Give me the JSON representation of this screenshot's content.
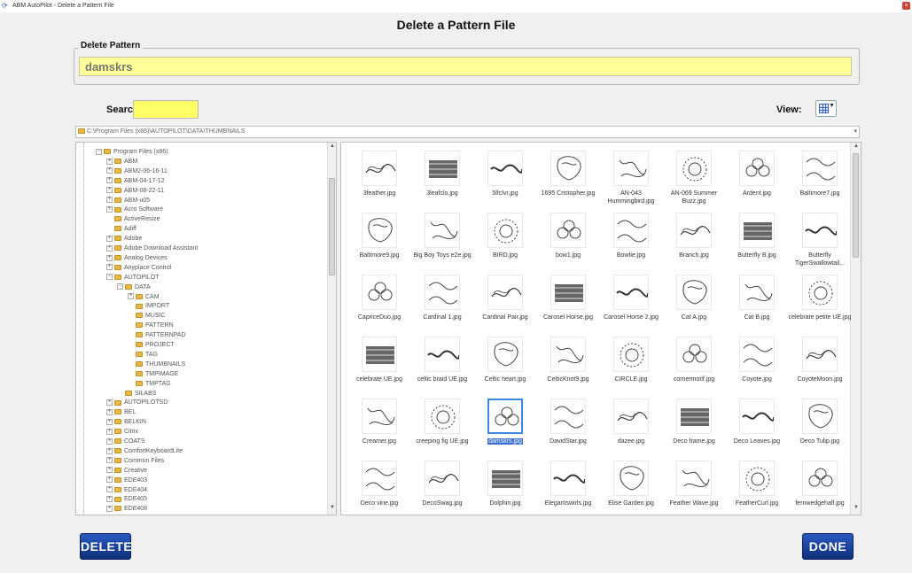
{
  "window": {
    "title": "ABM AutoPilot - Delete a Pattern File",
    "close_glyph": "×"
  },
  "dialog": {
    "title": "Delete a Pattern File"
  },
  "delete_pattern": {
    "legend": "Delete Pattern",
    "value": "damskrs"
  },
  "search": {
    "label": "Search:",
    "value": ""
  },
  "view": {
    "label": "View:"
  },
  "path": {
    "value": "C:\\Program Files (x86)\\AUTOPILOT\\DATA\\THUMBNAILS"
  },
  "tree": {
    "items": [
      {
        "label": "Program Files (x86)",
        "depth": 1,
        "toggle": "−"
      },
      {
        "label": "ABM",
        "depth": 2,
        "toggle": "+"
      },
      {
        "label": "ABM2-06-16-11",
        "depth": 2,
        "toggle": "+"
      },
      {
        "label": "ABM-04-17-12",
        "depth": 2,
        "toggle": "+"
      },
      {
        "label": "ABM-08-22-11",
        "depth": 2,
        "toggle": "+"
      },
      {
        "label": "ABM-u05",
        "depth": 2,
        "toggle": "+"
      },
      {
        "label": "Acro Software",
        "depth": 2,
        "toggle": "+"
      },
      {
        "label": "ActiveResize",
        "depth": 2,
        "toggle": ""
      },
      {
        "label": "Adiff",
        "depth": 2,
        "toggle": ""
      },
      {
        "label": "Adobe",
        "depth": 2,
        "toggle": "+"
      },
      {
        "label": "Adobe Download Assistant",
        "depth": 2,
        "toggle": "+"
      },
      {
        "label": "Analog Devices",
        "depth": 2,
        "toggle": "+"
      },
      {
        "label": "Anyplace Control",
        "depth": 2,
        "toggle": "+"
      },
      {
        "label": "AUTOPILOT",
        "depth": 2,
        "toggle": "−"
      },
      {
        "label": "DATA",
        "depth": 3,
        "toggle": "−"
      },
      {
        "label": "CAM",
        "depth": 4,
        "toggle": "+"
      },
      {
        "label": "IMPORT",
        "depth": 4,
        "toggle": ""
      },
      {
        "label": "MUSIC",
        "depth": 4,
        "toggle": ""
      },
      {
        "label": "PATTERN",
        "depth": 4,
        "toggle": ""
      },
      {
        "label": "PATTERNPAD",
        "depth": 4,
        "toggle": ""
      },
      {
        "label": "PROJECT",
        "depth": 4,
        "toggle": ""
      },
      {
        "label": "TAG",
        "depth": 4,
        "toggle": ""
      },
      {
        "label": "THUMBNAILS",
        "depth": 4,
        "toggle": ""
      },
      {
        "label": "TMPIMAGE",
        "depth": 4,
        "toggle": ""
      },
      {
        "label": "TMPTAG",
        "depth": 4,
        "toggle": ""
      },
      {
        "label": "SILABS",
        "depth": 3,
        "toggle": ""
      },
      {
        "label": "AUTOPILOTSD",
        "depth": 2,
        "toggle": "+"
      },
      {
        "label": "BEL",
        "depth": 2,
        "toggle": "+"
      },
      {
        "label": "BELKIN",
        "depth": 2,
        "toggle": "+"
      },
      {
        "label": "Citrix",
        "depth": 2,
        "toggle": "+"
      },
      {
        "label": "COATS",
        "depth": 2,
        "toggle": "+"
      },
      {
        "label": "ComfortKeyboardLite",
        "depth": 2,
        "toggle": "+"
      },
      {
        "label": "Common Files",
        "depth": 2,
        "toggle": "+"
      },
      {
        "label": "Creative",
        "depth": 2,
        "toggle": "+"
      },
      {
        "label": "EDE403",
        "depth": 2,
        "toggle": "+"
      },
      {
        "label": "EDE404",
        "depth": 2,
        "toggle": "+"
      },
      {
        "label": "EDE405",
        "depth": 2,
        "toggle": "+"
      },
      {
        "label": "EDE408",
        "depth": 2,
        "toggle": "+"
      }
    ]
  },
  "thumbnails": [
    {
      "label": "3feather.jpg"
    },
    {
      "label": "3leafclo.jpg"
    },
    {
      "label": "5lfclvr.jpg"
    },
    {
      "label": "1695 Cristopher.jpg"
    },
    {
      "label": "AN-043 Hummingbird.jpg"
    },
    {
      "label": "AN-069 Summer Buzz.jpg"
    },
    {
      "label": "Ardent.jpg"
    },
    {
      "label": "Baltimore7.jpg"
    },
    {
      "label": "Baltimore9.jpg"
    },
    {
      "label": "Big Boy Toys e2e.jpg"
    },
    {
      "label": "BIRD.jpg"
    },
    {
      "label": "bow1.jpg"
    },
    {
      "label": "Bowtie.jpg"
    },
    {
      "label": "Branch.jpg"
    },
    {
      "label": "Butterfly B.jpg"
    },
    {
      "label": "Butterfly TigerSwallowtail..."
    },
    {
      "label": "CapriceDuo.jpg"
    },
    {
      "label": "Cardinal 1.jpg"
    },
    {
      "label": "Cardinal Pair.jpg"
    },
    {
      "label": "Carosel Horse.jpg"
    },
    {
      "label": "Carosel Horse 2.jpg"
    },
    {
      "label": "Cat A.jpg"
    },
    {
      "label": "Cat B.jpg"
    },
    {
      "label": "celebrate petite UE.jpg"
    },
    {
      "label": "celebrate UE.jpg"
    },
    {
      "label": "celtic braid UE.jpg"
    },
    {
      "label": "Celtic heart.jpg"
    },
    {
      "label": "CelticKnot9.jpg"
    },
    {
      "label": "CIRCLE.jpg"
    },
    {
      "label": "cornermotif.jpg"
    },
    {
      "label": "Coyote.jpg"
    },
    {
      "label": "CoyoteMoon.jpg"
    },
    {
      "label": "Creamer.jpg"
    },
    {
      "label": "creeping fig UE.jpg"
    },
    {
      "label": "damskrs.jpg",
      "selected": true
    },
    {
      "label": "DavidStar.jpg"
    },
    {
      "label": "dazee.jpg"
    },
    {
      "label": "Deco frame.jpg"
    },
    {
      "label": "Deco Leaves.jpg"
    },
    {
      "label": "Deco Tulip.jpg"
    },
    {
      "label": "Deco vine.jpg"
    },
    {
      "label": "DecoSwag.jpg"
    },
    {
      "label": "Dolphin.jpg"
    },
    {
      "label": "Elegantswirls.jpg"
    },
    {
      "label": "Elise Garden.jpg"
    },
    {
      "label": "Feather Wave.jpg"
    },
    {
      "label": "FeatherCurl.jpg"
    },
    {
      "label": "fernwedgehalf.jpg"
    }
  ],
  "buttons": {
    "delete": "DELETE",
    "done": "DONE"
  },
  "colors": {
    "input_yellow": "#ffff99",
    "search_yellow": "#ffff66",
    "button_blue": "#1a44a0",
    "selection": "#3a6fd0"
  }
}
